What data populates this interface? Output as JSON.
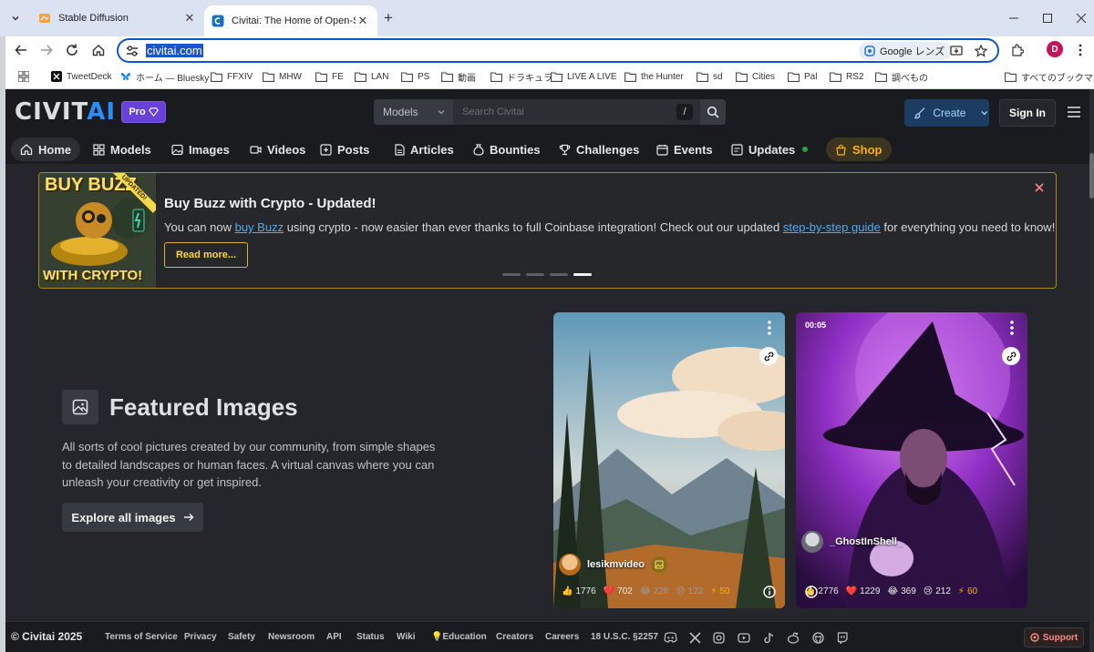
{
  "browser": {
    "tabs": [
      {
        "title": "Stable Diffusion",
        "active": false
      },
      {
        "title": "Civitai: The Home of Open-Source",
        "active": true
      }
    ],
    "url": "civitai.com",
    "lens_label": "Google レンズ",
    "profile_initial": "D",
    "bookmarks": [
      {
        "label": "TweetDeck",
        "icon": "x-logo-icon"
      },
      {
        "label": "ホーム — Bluesky",
        "icon": "bluesky-icon"
      },
      {
        "label": "FFXIV",
        "icon": "folder-icon"
      },
      {
        "label": "MHW",
        "icon": "folder-icon"
      },
      {
        "label": "FE",
        "icon": "folder-icon"
      },
      {
        "label": "LAN",
        "icon": "folder-icon"
      },
      {
        "label": "PS",
        "icon": "folder-icon"
      },
      {
        "label": "動画",
        "icon": "folder-icon"
      },
      {
        "label": "ドラキュラ",
        "icon": "folder-icon"
      },
      {
        "label": "LIVE A LIVE",
        "icon": "folder-icon"
      },
      {
        "label": "the Hunter",
        "icon": "folder-icon"
      },
      {
        "label": "sd",
        "icon": "folder-icon"
      },
      {
        "label": "Cities",
        "icon": "folder-icon"
      },
      {
        "label": "Pal",
        "icon": "folder-icon"
      },
      {
        "label": "RS2",
        "icon": "folder-icon"
      },
      {
        "label": "調べもの",
        "icon": "folder-icon"
      }
    ],
    "all_bookmarks": "すべてのブックマーク"
  },
  "header": {
    "logo_part1": "CIVIT",
    "logo_part2": "AI",
    "pro_label": "Pro",
    "search_category": "Models",
    "search_placeholder": "Search Civitai",
    "search_shortcut": "/",
    "create_label": "Create",
    "signin_label": "Sign In"
  },
  "nav": {
    "items": [
      {
        "label": "Home",
        "icon": "home-icon"
      },
      {
        "label": "Models",
        "icon": "models-icon"
      },
      {
        "label": "Images",
        "icon": "image-icon"
      },
      {
        "label": "Videos",
        "icon": "video-icon"
      },
      {
        "label": "Posts",
        "icon": "posts-icon"
      },
      {
        "label": "Articles",
        "icon": "article-icon"
      },
      {
        "label": "Bounties",
        "icon": "bounty-icon"
      },
      {
        "label": "Challenges",
        "icon": "trophy-icon"
      },
      {
        "label": "Events",
        "icon": "calendar-icon"
      },
      {
        "label": "Updates",
        "icon": "updates-icon"
      },
      {
        "label": "Shop",
        "icon": "shop-icon"
      }
    ]
  },
  "announcement": {
    "art_top": "BUY BUZZ",
    "art_ribbon": "UPDATED!",
    "art_bottom": "WITH CRYPTO!",
    "title": "Buy Buzz with Crypto - Updated!",
    "body_1": "You can now ",
    "link_1": "buy Buzz",
    "body_2": " using crypto - now easier than ever thanks to full Coinbase integration! Check out our updated ",
    "link_2": "step-by-step guide",
    "body_3": " for everything you need to know!",
    "cta": "Read more...",
    "slide_count": 4,
    "active_slide": 4
  },
  "featured": {
    "title": "Featured Images",
    "description": "All sorts of cool pictures created by our community, from simple shapes to detailed landscapes or human faces. A virtual canvas where you can unleash your creativity or get inspired.",
    "cta": "Explore all images"
  },
  "cards": [
    {
      "username": "lesikmvideo",
      "badge": "",
      "stats": {
        "likes": "1776",
        "hearts": "702",
        "laughs": "228",
        "cries": "122",
        "buzz": "50"
      }
    },
    {
      "username": "_GhostInShell_",
      "badge": "00:05",
      "stats": {
        "likes": "2776",
        "hearts": "1229",
        "laughs": "369",
        "cries": "212",
        "buzz": "60"
      }
    }
  ],
  "footer": {
    "copyright": "© Civitai 2025",
    "links": [
      "Terms of Service",
      "Privacy",
      "Safety",
      "Newsroom",
      "API",
      "Status",
      "Wiki",
      "Education",
      "Creators",
      "Careers",
      "18 U.S.C. §2257"
    ],
    "support": "Support"
  },
  "colors": {
    "accent": "#228be6",
    "pro": "#6741d9",
    "shop": "#fab005",
    "banner_border": "#a8891c"
  }
}
